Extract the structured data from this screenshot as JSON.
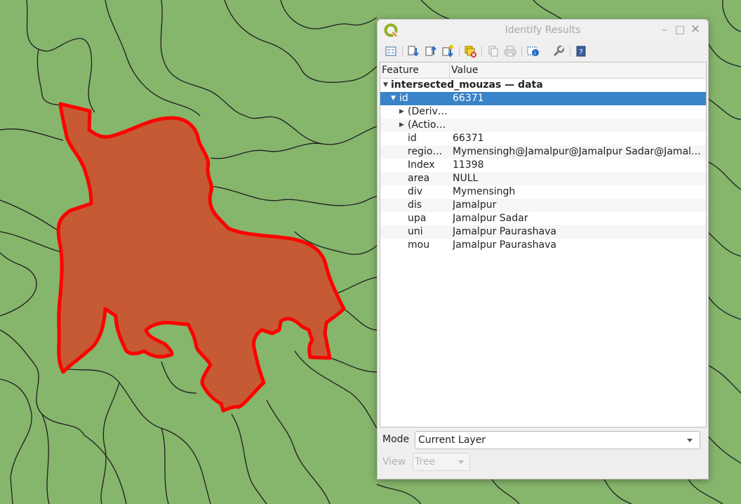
{
  "window": {
    "title": "Identify Results"
  },
  "colors": {
    "map_fill": "#86b56c",
    "selected_feature": "#c55a35",
    "highlight_outline": "#ff0000",
    "selection": "#3a83c8"
  },
  "toolbar": {
    "icons": [
      "expand-tree-icon",
      "expand-all-icon",
      "collapse-all-icon",
      "expand-new-icon",
      "clear-results-icon",
      "copy-feature-icon",
      "print-icon",
      "identify-select-icon",
      "settings-icon",
      "help-icon"
    ]
  },
  "tree": {
    "headers": {
      "feature": "Feature",
      "value": "Value"
    },
    "layer": "intersected_mouzas — data",
    "feature": {
      "key": "id",
      "value": "66371"
    },
    "groups": [
      {
        "label": "(Derived)",
        "display": "(Deriv…"
      },
      {
        "label": "(Actions)",
        "display": "(Actio…"
      }
    ],
    "attributes": [
      {
        "key": "id",
        "value": "66371"
      },
      {
        "key": "regio…",
        "value": "Mymensingh@Jamalpur@Jamalpur Sadar@Jamal…"
      },
      {
        "key": "Index",
        "value": "11398"
      },
      {
        "key": "area",
        "value": "NULL"
      },
      {
        "key": "div",
        "value": "Mymensingh"
      },
      {
        "key": "dis",
        "value": "Jamalpur"
      },
      {
        "key": "upa",
        "value": "Jamalpur Sadar"
      },
      {
        "key": "uni",
        "value": "Jamalpur Paurashava"
      },
      {
        "key": "mou",
        "value": "Jamalpur Paurashava"
      }
    ]
  },
  "mode": {
    "label": "Mode",
    "value": "Current Layer"
  },
  "view": {
    "label": "View",
    "value": "Tree"
  }
}
